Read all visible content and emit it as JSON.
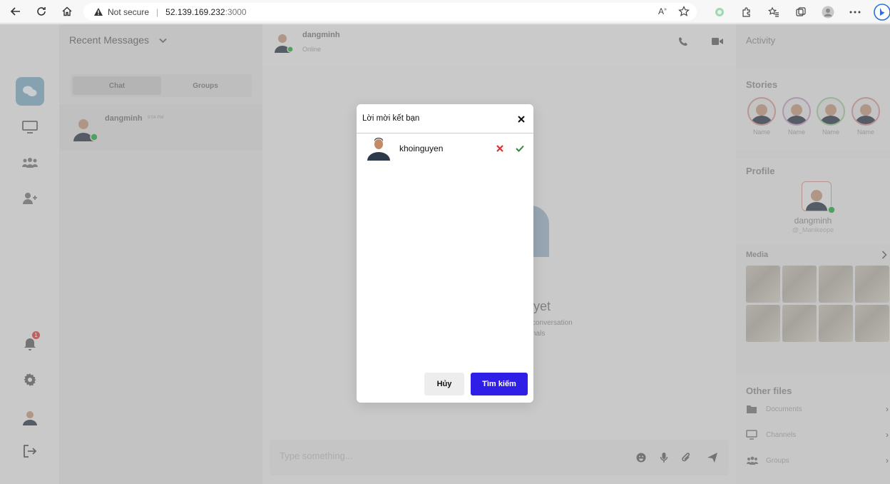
{
  "browser": {
    "security_label": "Not secure",
    "url_host": "52.139.169.232",
    "url_port": ":3000"
  },
  "sidebar": {
    "notification_count": "1"
  },
  "messages": {
    "title": "Recent Messages",
    "tabs": [
      {
        "label": "Chat"
      },
      {
        "label": "Groups"
      }
    ],
    "conversation": {
      "name": "dangminh",
      "time": "9:04 PM"
    }
  },
  "chat": {
    "contact_name": "dangminh",
    "contact_status": "Online",
    "empty_title": "yet",
    "empty_line1": "conversation",
    "empty_line2": "nals",
    "composer_placeholder": "Type something..."
  },
  "activity": {
    "title": "Activity",
    "stories_title": "Stories",
    "stories": [
      {
        "name": "Name"
      },
      {
        "name": "Name"
      },
      {
        "name": "Name"
      },
      {
        "name": "Name"
      }
    ],
    "profile_title": "Profile",
    "profile_name": "dangminh",
    "profile_handle": "@_Manikeope",
    "media_title": "Media",
    "other_files_title": "Other files",
    "files": [
      {
        "label": "Documents"
      },
      {
        "label": "Channels"
      },
      {
        "label": "Groups"
      }
    ]
  },
  "modal": {
    "title": "Lời mời kết bạn",
    "requests": [
      {
        "name": "khoinguyen"
      }
    ],
    "cancel_label": "Hủy",
    "search_label": "Tìm kiếm"
  },
  "colors": {
    "primary": "#2f1fe6",
    "reject": "#e0312f",
    "accept": "#2e8b3a",
    "online": "#45b35a"
  }
}
